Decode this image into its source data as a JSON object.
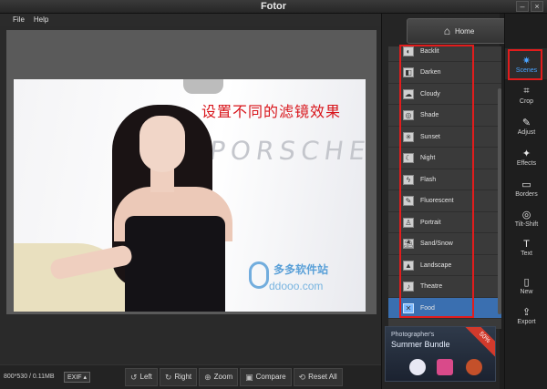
{
  "window": {
    "title": "Fotor"
  },
  "menu": [
    "File",
    "Help"
  ],
  "photo": {
    "overlay_text": "设置不同的滤镜效果",
    "brand_text": "PORSCHE",
    "watermark": {
      "name": "多多软件站",
      "url": "ddooo.com"
    }
  },
  "status": {
    "image_info": "800*530 / 0.11MB",
    "exif_label": "EXIF ▴"
  },
  "toolbar": [
    {
      "icon": "rotate-left-icon",
      "glyph": "↺",
      "label": "Left"
    },
    {
      "icon": "rotate-right-icon",
      "glyph": "↻",
      "label": "Right"
    },
    {
      "icon": "zoom-icon",
      "glyph": "⊕",
      "label": "Zoom"
    },
    {
      "icon": "compare-icon",
      "glyph": "▣",
      "label": "Compare"
    },
    {
      "icon": "reset-icon",
      "glyph": "⟲",
      "label": "Reset All"
    }
  ],
  "home_label": "Home",
  "scenes": [
    {
      "label": "Backlit",
      "glyph": "◐"
    },
    {
      "label": "Darken",
      "glyph": "◧"
    },
    {
      "label": "Cloudy",
      "glyph": "☁"
    },
    {
      "label": "Shade",
      "glyph": "◎"
    },
    {
      "label": "Sunset",
      "glyph": "✳"
    },
    {
      "label": "Night",
      "glyph": "☾"
    },
    {
      "label": "Flash",
      "glyph": "ϟ"
    },
    {
      "label": "Fluorescent",
      "glyph": "✎"
    },
    {
      "label": "Portrait",
      "glyph": "♙"
    },
    {
      "label": "Sand/Snow",
      "glyph": "⛱"
    },
    {
      "label": "Landscape",
      "glyph": "▲"
    },
    {
      "label": "Theatre",
      "glyph": "♪"
    },
    {
      "label": "Food",
      "glyph": "✕",
      "active": true
    }
  ],
  "promo": {
    "line1": "Photographer's",
    "line2": "Summer Bundle",
    "discount": "50%"
  },
  "sidebar": [
    {
      "label": "Scenes",
      "glyph": "✷",
      "icon": "scenes-icon",
      "active": true
    },
    {
      "label": "Crop",
      "glyph": "⌗",
      "icon": "crop-icon"
    },
    {
      "label": "Adjust",
      "glyph": "✎",
      "icon": "adjust-icon"
    },
    {
      "label": "Effects",
      "glyph": "✦",
      "icon": "effects-icon"
    },
    {
      "label": "Borders",
      "glyph": "▭",
      "icon": "borders-icon"
    },
    {
      "label": "Tilt-Shift",
      "glyph": "◎",
      "icon": "tilt-shift-icon"
    },
    {
      "label": "Text",
      "glyph": "T",
      "icon": "text-icon"
    },
    {
      "label": "New",
      "glyph": "▯",
      "icon": "new-icon"
    },
    {
      "label": "Export",
      "glyph": "⇪",
      "icon": "export-icon"
    }
  ],
  "colors": {
    "accent": "#4aa3ff",
    "highlight": "#e21c1c",
    "active_scene": "#3a6fb0"
  }
}
